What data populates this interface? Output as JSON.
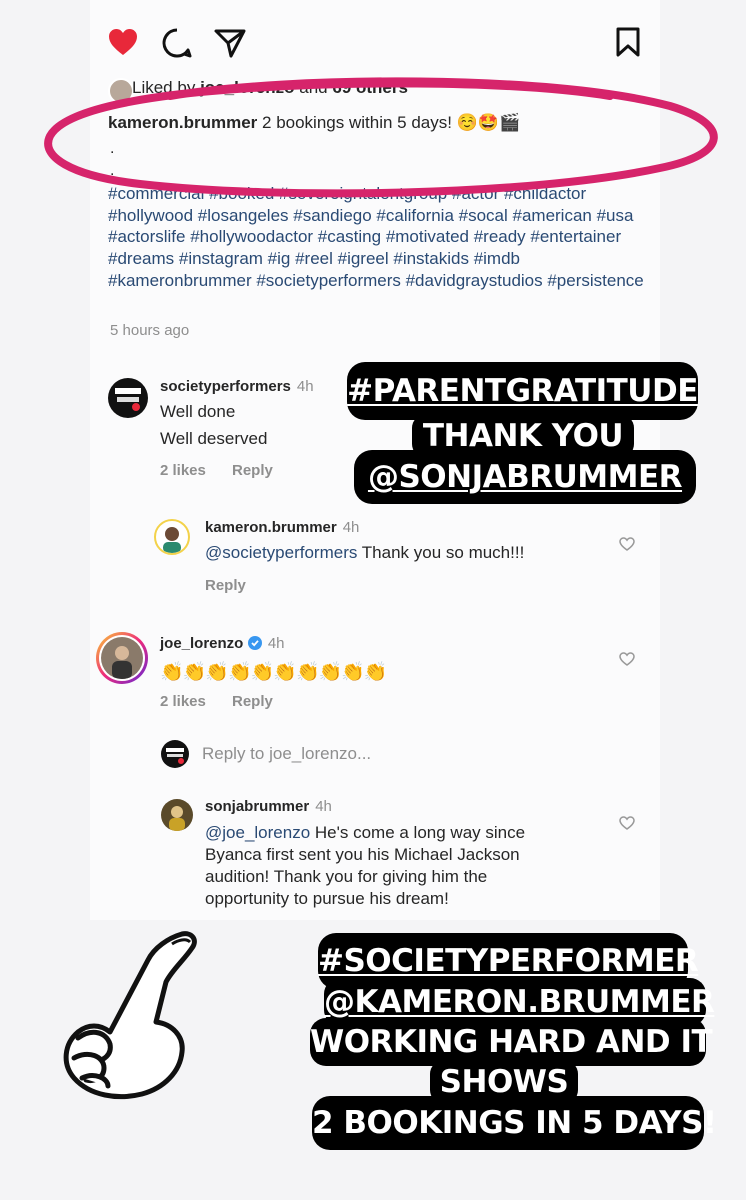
{
  "post": {
    "liked_by_prefix": "Liked by",
    "liked_by_user": "joe_lorenzo",
    "liked_by_and": "and",
    "liked_by_count": "69 others",
    "caption_user": "kameron.brummer",
    "caption_text": "2 bookings within 5 days! ☺️🤩🎬",
    "dot1": ".",
    "dot2": ".",
    "hashtags": "#commercial #booked #sovereigntalentgroup #actor #childactor #hollywood #losangeles #sandiego #california #socal #american #usa #actorslife #hollywoodactor #casting #motivated #ready #entertainer #dreams #instagram #ig #reel #igreel #instakids #imdb #kameronbrummer #societyperformers #davidgraystudios #persistence",
    "time": "5 hours ago"
  },
  "comments": [
    {
      "user": "societyperformers",
      "time": "4h",
      "line1": "Well done",
      "line2": "Well deserved",
      "likes": "2 likes",
      "reply": "Reply"
    },
    {
      "user": "kameron.brummer",
      "time": "4h",
      "mention": "@societyperformers",
      "text": "Thank you so much!!!",
      "reply": "Reply"
    },
    {
      "user": "joe_lorenzo",
      "time": "4h",
      "text": "👏👏👏👏👏👏👏👏👏👏",
      "likes": "2 likes",
      "reply": "Reply"
    },
    {
      "user": "sonjabrummer",
      "time": "4h",
      "mention": "@joe_lorenzo",
      "line1": "He's come a long way since",
      "line2": "Byanca first sent you his Michael Jackson",
      "line3": "audition! Thank you for giving him the",
      "line4": "opportunity to pursue his dream!"
    }
  ],
  "reply_box": {
    "placeholder": "Reply to joe_lorenzo..."
  },
  "sticker1": {
    "line1": "#PARENTGRATITUDE",
    "line2": "THANK YOU",
    "line3": "@SONJABRUMMER"
  },
  "sticker2": {
    "line1": "#SOCIETYPERFORMER",
    "line2": "@KAMERON.BRUMMER",
    "line3": "WORKING HARD AND IT",
    "line4": "SHOWS",
    "line5": "2 BOOKINGS IN 5 DAYS!"
  },
  "colors": {
    "heart": "#e8283a",
    "circle_annotation": "#d6246b",
    "hashtag": "#2a4a74",
    "verified": "#3897f0"
  },
  "icons": {
    "like": "heart-filled-icon",
    "comment": "comment-bubble-icon",
    "share": "paper-plane-icon",
    "save": "bookmark-icon",
    "pointing": "pointing-hand-icon"
  }
}
